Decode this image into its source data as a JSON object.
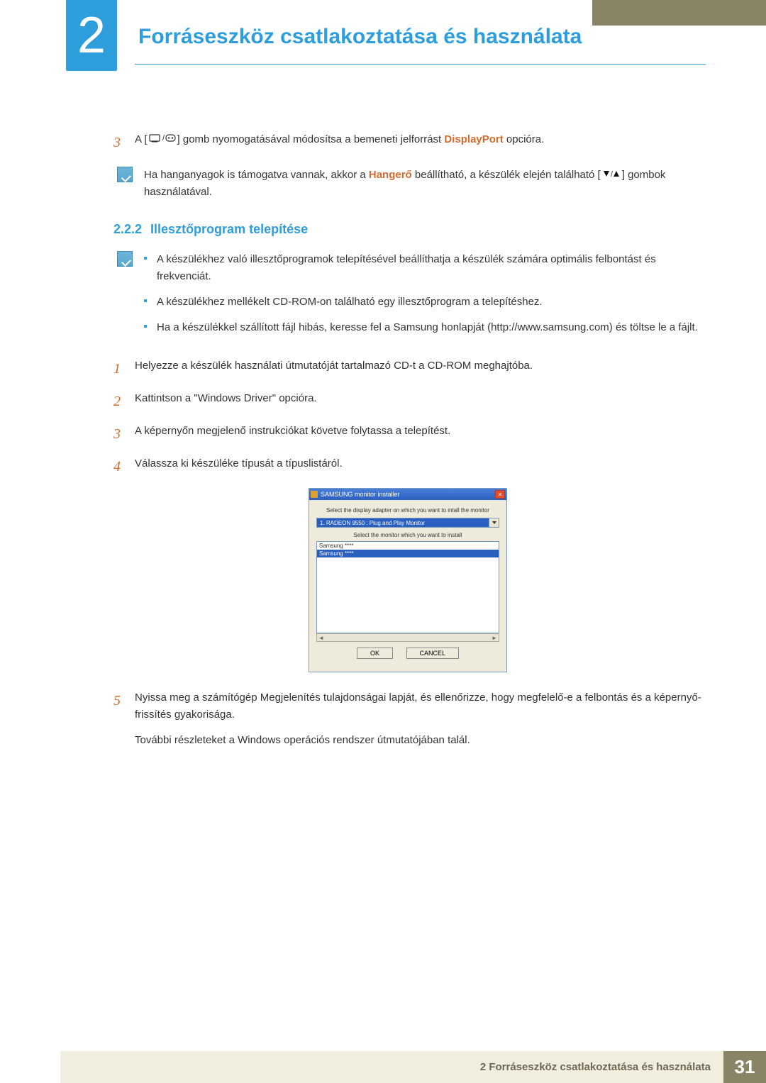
{
  "chapter": {
    "number": "2",
    "title": "Forráseszköz csatlakoztatása és használata"
  },
  "step3_top": {
    "n": "3",
    "before": "A [",
    "after_icon": "] gomb nyomogatásával módosítsa a bemeneti jelforrást ",
    "emph": "DisplayPort",
    "tail": " opcióra."
  },
  "note_top": {
    "before": "Ha hanganyagok is támogatva vannak, akkor a ",
    "emph": "Hangerő",
    "after": " beállítható, a készülék elején található [",
    "after_icon": "] gombok használatával."
  },
  "subheading": {
    "num": "2.2.2",
    "title": "Illesztőprogram telepítése"
  },
  "note_list": [
    "A készülékhez való illesztőprogramok telepítésével beállíthatja a készülék számára optimális felbontást és frekvenciát.",
    "A készülékhez mellékelt CD-ROM-on található egy illesztőprogram a telepítéshez.",
    "Ha a készülékkel szállított fájl hibás, keresse fel a Samsung honlapját (http://www.samsung.com) és töltse le a fájlt."
  ],
  "steps": [
    {
      "n": "1",
      "t": "Helyezze a készülék használati útmutatóját tartalmazó CD-t a CD-ROM meghajtóba."
    },
    {
      "n": "2",
      "t": "Kattintson a \"Windows Driver\" opcióra."
    },
    {
      "n": "3",
      "t": "A képernyőn megjelenő instrukciókat követve folytassa a telepítést."
    },
    {
      "n": "4",
      "t": "Válassza ki készüléke típusát a típuslistáról."
    }
  ],
  "dialog": {
    "title": "SAMSUNG monitor installer",
    "label1": "Select the display adapter on which you want to intall the monitor",
    "selected_adapter": "1. RADEON 9550 : Plug and Play Monitor",
    "label2": "Select the monitor which you want to install",
    "list_item1": "Samsung ****",
    "list_item_sel": "Samsung ****",
    "btn_ok": "OK",
    "btn_cancel": "CANCEL"
  },
  "step5": {
    "n": "5",
    "line1": "Nyissa meg a számítógép Megjelenítés tulajdonságai lapját, és ellenőrizze, hogy megfelelő-e a felbontás és a képernyő-frissítés gyakorisága.",
    "line2": "További részleteket a Windows operációs rendszer útmutatójában talál."
  },
  "footer": {
    "text": "2 Forráseszköz csatlakoztatása és használata",
    "page": "31"
  }
}
